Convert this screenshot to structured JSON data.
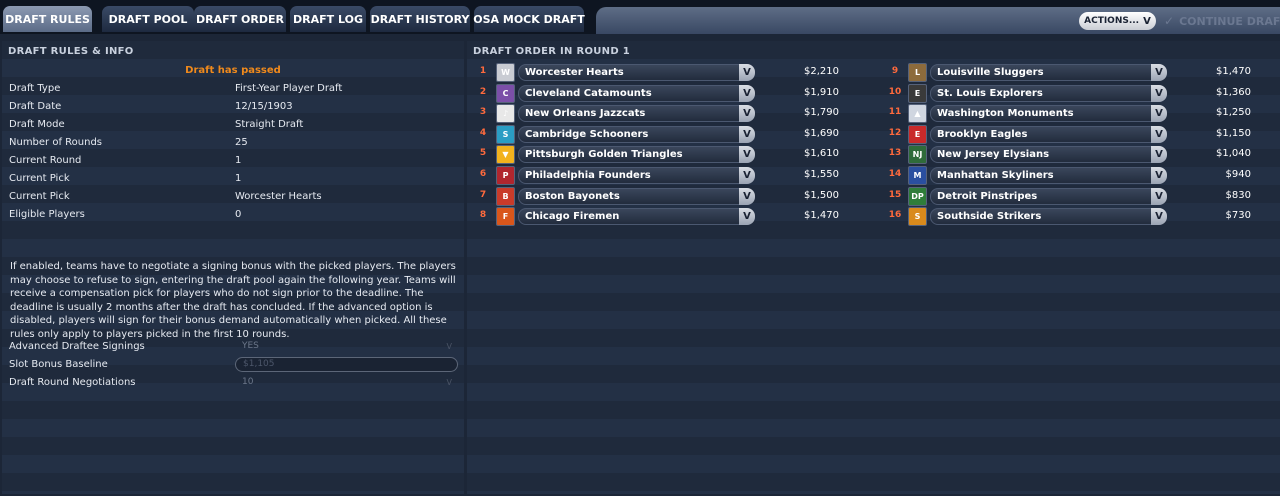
{
  "tabs": [
    {
      "label": "DRAFT RULES",
      "active": true
    },
    {
      "label": "DRAFT POOL",
      "active": false
    },
    {
      "label": "DRAFT ORDER",
      "active": false
    },
    {
      "label": "DRAFT LOG",
      "active": false
    },
    {
      "label": "DRAFT HISTORY",
      "active": false
    },
    {
      "label": "OSA MOCK DRAFT",
      "active": false
    }
  ],
  "toolbar": {
    "actions_label": "ACTIONS...",
    "actions_chevron": "V",
    "continue_label": "CONTINUE DRAFT"
  },
  "rules": {
    "title": "DRAFT RULES & INFO",
    "status": "Draft has passed",
    "rows": [
      {
        "label": "Draft Type",
        "value": "First-Year Player Draft"
      },
      {
        "label": "Draft Date",
        "value": "12/15/1903"
      },
      {
        "label": "Draft Mode",
        "value": "Straight Draft"
      },
      {
        "label": "Number of Rounds",
        "value": "25"
      },
      {
        "label": "Current Round",
        "value": "1"
      },
      {
        "label": "Current Pick",
        "value": "1"
      },
      {
        "label": "Current Pick",
        "value": "Worcester Hearts"
      },
      {
        "label": "Eligible Players",
        "value": "0"
      }
    ],
    "description": "If enabled, teams have to negotiate a signing bonus with the picked players. The players may choose to refuse to sign, entering the draft pool again the following year. Teams will receive a compensation pick for players who do not sign prior to the deadline. The deadline is usually 2 months after the draft has concluded. If the advanced option is disabled, players will sign for their bonus demand automatically when picked. All these rules only apply to players picked in the first 10 rounds.",
    "options": [
      {
        "label": "Advanced Draftee Signings",
        "value": "YES",
        "kind": "select"
      },
      {
        "label": "Slot Bonus Baseline",
        "value": "$1,105",
        "kind": "text"
      },
      {
        "label": "Draft Round Negotiations",
        "value": "10",
        "kind": "select"
      }
    ],
    "select_arrow": "V"
  },
  "order": {
    "title": "DRAFT ORDER IN ROUND 1",
    "chevron": "V",
    "picks": [
      {
        "num": "1",
        "team": "Worcester Hearts",
        "amount": "$2,210",
        "logo_color": "#c9ccd3",
        "logo_glyph": "W"
      },
      {
        "num": "2",
        "team": "Cleveland Catamounts",
        "amount": "$1,910",
        "logo_color": "#7b4fa8",
        "logo_glyph": "C"
      },
      {
        "num": "3",
        "team": "New Orleans Jazzcats",
        "amount": "$1,790",
        "logo_color": "#e8e8e8",
        "logo_glyph": "♪"
      },
      {
        "num": "4",
        "team": "Cambridge Schooners",
        "amount": "$1,690",
        "logo_color": "#2a9dc4",
        "logo_glyph": "S"
      },
      {
        "num": "5",
        "team": "Pittsburgh Golden Triangles",
        "amount": "$1,610",
        "logo_color": "#f2b21d",
        "logo_glyph": "▼"
      },
      {
        "num": "6",
        "team": "Philadelphia Founders",
        "amount": "$1,550",
        "logo_color": "#b0262e",
        "logo_glyph": "P"
      },
      {
        "num": "7",
        "team": "Boston Bayonets",
        "amount": "$1,500",
        "logo_color": "#c93b2a",
        "logo_glyph": "B"
      },
      {
        "num": "8",
        "team": "Chicago Firemen",
        "amount": "$1,470",
        "logo_color": "#d9561b",
        "logo_glyph": "F"
      },
      {
        "num": "9",
        "team": "Louisville Sluggers",
        "amount": "$1,470",
        "logo_color": "#8d6b3c",
        "logo_glyph": "L"
      },
      {
        "num": "10",
        "team": "St. Louis Explorers",
        "amount": "$1,360",
        "logo_color": "#3a3a3a",
        "logo_glyph": "E"
      },
      {
        "num": "11",
        "team": "Washington Monuments",
        "amount": "$1,250",
        "logo_color": "#d0d6e0",
        "logo_glyph": "▲"
      },
      {
        "num": "12",
        "team": "Brooklyn Eagles",
        "amount": "$1,150",
        "logo_color": "#c92a2a",
        "logo_glyph": "E"
      },
      {
        "num": "13",
        "team": "New Jersey Elysians",
        "amount": "$1,040",
        "logo_color": "#2f6b3a",
        "logo_glyph": "NJ"
      },
      {
        "num": "14",
        "team": "Manhattan Skyliners",
        "amount": "$940",
        "logo_color": "#2a4fa0",
        "logo_glyph": "M"
      },
      {
        "num": "15",
        "team": "Detroit Pinstripes",
        "amount": "$830",
        "logo_color": "#2f7d3a",
        "logo_glyph": "DP"
      },
      {
        "num": "16",
        "team": "Southside Strikers",
        "amount": "$730",
        "logo_color": "#d98a1c",
        "logo_glyph": "S"
      }
    ]
  }
}
